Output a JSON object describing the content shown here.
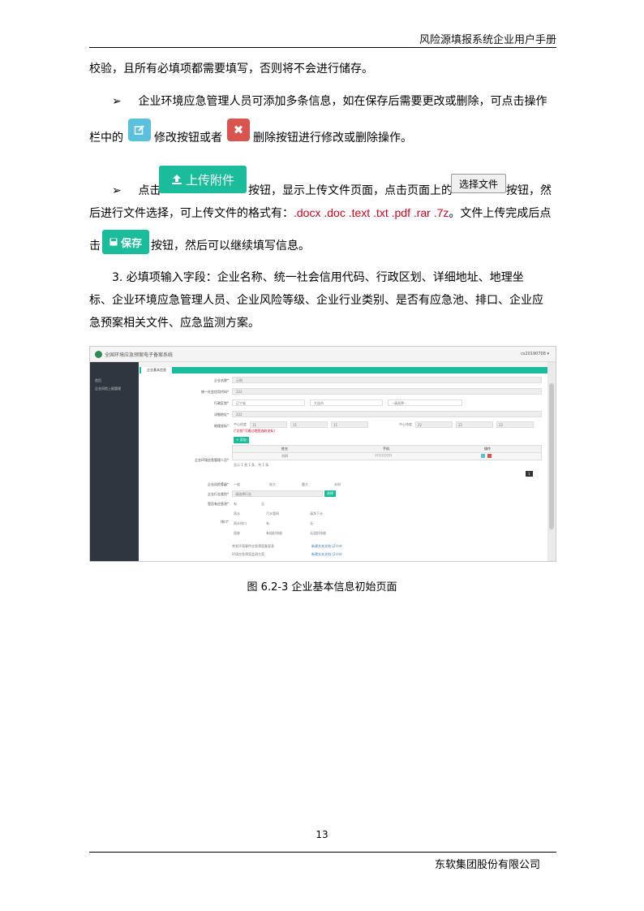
{
  "header": {
    "title": "风险源填报系统企业用户手册"
  },
  "body": {
    "line1": "校验，且所有必填项都需要填写，否则将不会进行储存。",
    "bullet_symbol": "➢",
    "line2": "企业环境应急管理人员可添加多条信息，如在保存后需要更改或删除，可点击操作",
    "line3a": "栏中的",
    "line3b": "修改按钮或者",
    "line3c": "删除按钮进行修改或删除操作。",
    "line4a": "点击",
    "line4b": "按钮，显示上传文件页面，点击页面上的",
    "line4c": "按钮，然",
    "line5a": "后进行文件选择，可上传文件的格式有：",
    "line5_formats": ".docx .doc .text .txt .pdf .rar .7z",
    "line5b": "。文件上传完成后点",
    "line6a": "击",
    "line6b": "按钮，然后可以继续填写信息。",
    "line7": "3.   必填项输入字段：企业名称、统一社会信用代码、行政区划、详细地址、地理坐",
    "line8": "标、企业环境应急管理人员、企业风险等级、企业行业类别、是否有应急池、排口、企业应",
    "line9": "急预案相关文件、应急监测方案。"
  },
  "buttons": {
    "edit_icon": "edit-icon",
    "delete_icon": "close-icon",
    "delete_glyph": "✖",
    "upload_label": "上传附件",
    "select_file_label": "选择文件",
    "save_label": "保存"
  },
  "screenshot": {
    "app_title": "全国环境应急预案电子备案系统",
    "user": "cs20190708 ▾",
    "sidebar": [
      "首页",
      "企业风险上报管理"
    ],
    "tab": "企业基本信息",
    "labels": [
      "企业名称*",
      "统一社会信用代码*",
      "行政区划*",
      "详细地址*",
      "地理坐标*",
      "企业环境应急管理人员*",
      "企业风险等级*",
      "企业行业类别*",
      "是否有应急池*",
      "排口*"
    ],
    "name_value": "示例",
    "code_value": "222",
    "region": [
      "辽宁省",
      "大连市",
      "--请选择--"
    ],
    "address_value": "222",
    "coord_hint": "(\"文档\"可通过地图选取坐标)",
    "coord_labels": [
      "中心经度",
      "中心纬度"
    ],
    "coord_values": [
      "11",
      "11",
      "11",
      "22",
      "22",
      "22"
    ],
    "add_btn": "+ 添加",
    "table_headers": [
      "姓名",
      "手机",
      "操作"
    ],
    "table_row": [
      "刘四",
      "??????????"
    ],
    "paging": "显示 1 到 1 条，共 1 条",
    "page_no": "1",
    "risk_levels": [
      "一般",
      "较大",
      "重大",
      "未知"
    ],
    "industry_placeholder": "请选择行业",
    "industry_btn": "选择",
    "pool": [
      "有",
      "无"
    ],
    "outlets": [
      "雨水",
      "污水管网",
      "清净下水",
      "雨水排口",
      "有",
      "无",
      "固废",
      "有组织排放",
      "无组织排放"
    ],
    "files": [
      "突发环境事件应急预案备案表",
      "环境应急预案监测方案"
    ],
    "file_link": "新建文本文档 (2).txt"
  },
  "caption": "图 6.2-3 企业基本信息初始页面",
  "page_number": "13",
  "footer": {
    "company": "东软集团股份有限公司"
  },
  "colors": {
    "teal": "#1abc9c",
    "edit_blue": "#5bc0de",
    "delete_red": "#d9534f",
    "format_red": "#d9001b"
  }
}
